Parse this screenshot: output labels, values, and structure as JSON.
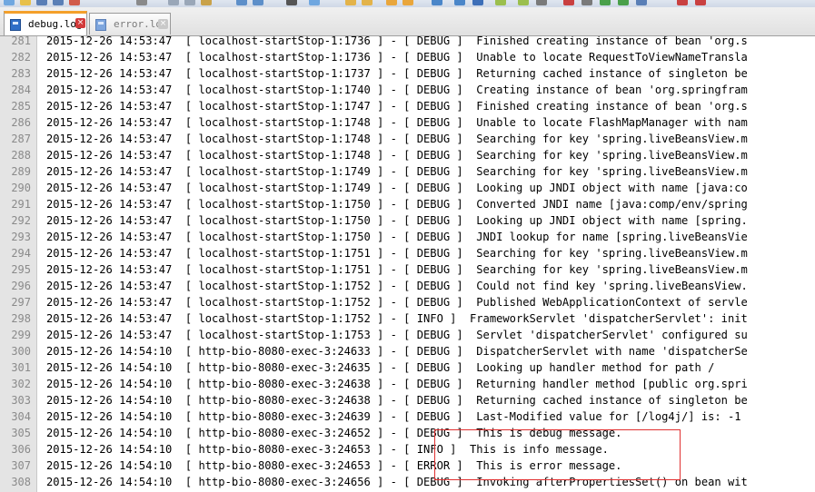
{
  "tabs": [
    {
      "label": "debug.log",
      "active": true
    },
    {
      "label": "error.log",
      "active": false
    }
  ],
  "close_glyph": "×",
  "lines": [
    {
      "num": "281",
      "text": "2015-12-26 14:53:47  [ localhost-startStop-1:1736 ] - [ DEBUG ]  Finished creating instance of bean 'org.s"
    },
    {
      "num": "282",
      "text": "2015-12-26 14:53:47  [ localhost-startStop-1:1736 ] - [ DEBUG ]  Unable to locate RequestToViewNameTransla"
    },
    {
      "num": "283",
      "text": "2015-12-26 14:53:47  [ localhost-startStop-1:1737 ] - [ DEBUG ]  Returning cached instance of singleton be"
    },
    {
      "num": "284",
      "text": "2015-12-26 14:53:47  [ localhost-startStop-1:1740 ] - [ DEBUG ]  Creating instance of bean 'org.springfram"
    },
    {
      "num": "285",
      "text": "2015-12-26 14:53:47  [ localhost-startStop-1:1747 ] - [ DEBUG ]  Finished creating instance of bean 'org.s"
    },
    {
      "num": "286",
      "text": "2015-12-26 14:53:47  [ localhost-startStop-1:1748 ] - [ DEBUG ]  Unable to locate FlashMapManager with nam"
    },
    {
      "num": "287",
      "text": "2015-12-26 14:53:47  [ localhost-startStop-1:1748 ] - [ DEBUG ]  Searching for key 'spring.liveBeansView.m"
    },
    {
      "num": "288",
      "text": "2015-12-26 14:53:47  [ localhost-startStop-1:1748 ] - [ DEBUG ]  Searching for key 'spring.liveBeansView.m"
    },
    {
      "num": "289",
      "text": "2015-12-26 14:53:47  [ localhost-startStop-1:1749 ] - [ DEBUG ]  Searching for key 'spring.liveBeansView.m"
    },
    {
      "num": "290",
      "text": "2015-12-26 14:53:47  [ localhost-startStop-1:1749 ] - [ DEBUG ]  Looking up JNDI object with name [java:co"
    },
    {
      "num": "291",
      "text": "2015-12-26 14:53:47  [ localhost-startStop-1:1750 ] - [ DEBUG ]  Converted JNDI name [java:comp/env/spring"
    },
    {
      "num": "292",
      "text": "2015-12-26 14:53:47  [ localhost-startStop-1:1750 ] - [ DEBUG ]  Looking up JNDI object with name [spring."
    },
    {
      "num": "293",
      "text": "2015-12-26 14:53:47  [ localhost-startStop-1:1750 ] - [ DEBUG ]  JNDI lookup for name [spring.liveBeansVie"
    },
    {
      "num": "294",
      "text": "2015-12-26 14:53:47  [ localhost-startStop-1:1751 ] - [ DEBUG ]  Searching for key 'spring.liveBeansView.m"
    },
    {
      "num": "295",
      "text": "2015-12-26 14:53:47  [ localhost-startStop-1:1751 ] - [ DEBUG ]  Searching for key 'spring.liveBeansView.m"
    },
    {
      "num": "296",
      "text": "2015-12-26 14:53:47  [ localhost-startStop-1:1752 ] - [ DEBUG ]  Could not find key 'spring.liveBeansView."
    },
    {
      "num": "297",
      "text": "2015-12-26 14:53:47  [ localhost-startStop-1:1752 ] - [ DEBUG ]  Published WebApplicationContext of servle"
    },
    {
      "num": "298",
      "text": "2015-12-26 14:53:47  [ localhost-startStop-1:1752 ] - [ INFO ]  FrameworkServlet 'dispatcherServlet': init"
    },
    {
      "num": "299",
      "text": "2015-12-26 14:53:47  [ localhost-startStop-1:1753 ] - [ DEBUG ]  Servlet 'dispatcherServlet' configured su"
    },
    {
      "num": "300",
      "text": "2015-12-26 14:54:10  [ http-bio-8080-exec-3:24633 ] - [ DEBUG ]  DispatcherServlet with name 'dispatcherSe"
    },
    {
      "num": "301",
      "text": "2015-12-26 14:54:10  [ http-bio-8080-exec-3:24635 ] - [ DEBUG ]  Looking up handler method for path /"
    },
    {
      "num": "302",
      "text": "2015-12-26 14:54:10  [ http-bio-8080-exec-3:24638 ] - [ DEBUG ]  Returning handler method [public org.spri"
    },
    {
      "num": "303",
      "text": "2015-12-26 14:54:10  [ http-bio-8080-exec-3:24638 ] - [ DEBUG ]  Returning cached instance of singleton be"
    },
    {
      "num": "304",
      "text": "2015-12-26 14:54:10  [ http-bio-8080-exec-3:24639 ] - [ DEBUG ]  Last-Modified value for [/log4j/] is: -1"
    },
    {
      "num": "305",
      "text": "2015-12-26 14:54:10  [ http-bio-8080-exec-3:24652 ] - [ DEBUG ]  This is debug message."
    },
    {
      "num": "306",
      "text": "2015-12-26 14:54:10  [ http-bio-8080-exec-3:24653 ] - [ INFO ]  This is info message."
    },
    {
      "num": "307",
      "text": "2015-12-26 14:54:10  [ http-bio-8080-exec-3:24653 ] - [ ERROR ]  This is error message."
    },
    {
      "num": "308",
      "text": "2015-12-26 14:54:10  [ http-bio-8080-exec-3:24656 ] - [ DEBUG ]  Invoking afterPropertiesSet() on bean wit"
    }
  ],
  "colors": {
    "highlight_border": "#e03030",
    "tab_accent": "#f4a02a",
    "gutter_bg": "#e4e4e4",
    "line_number": "#8a8a8a"
  }
}
